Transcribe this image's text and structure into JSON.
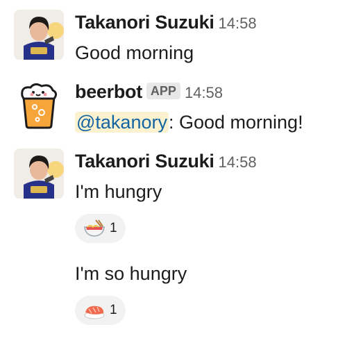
{
  "messages": [
    {
      "sender": "Takanori Suzuki",
      "time": "14:58",
      "text": "Good morning"
    },
    {
      "sender": "beerbot",
      "badge": "APP",
      "time": "14:58",
      "mention": "@takanory",
      "text_after_mention": ": Good morning!"
    },
    {
      "sender": "Takanori Suzuki",
      "time": "14:58",
      "lines": [
        {
          "text": "I'm hungry",
          "reaction": {
            "emoji": "ramen-icon",
            "count": "1"
          }
        },
        {
          "text": "I'm so hungry",
          "reaction": {
            "emoji": "sushi-icon",
            "count": "1"
          }
        }
      ]
    }
  ],
  "colors": {
    "mention_text": "#1264a3",
    "mention_bg": "#fcf2d0",
    "timestamp": "#616061",
    "reaction_bg": "#f2f2f2"
  }
}
